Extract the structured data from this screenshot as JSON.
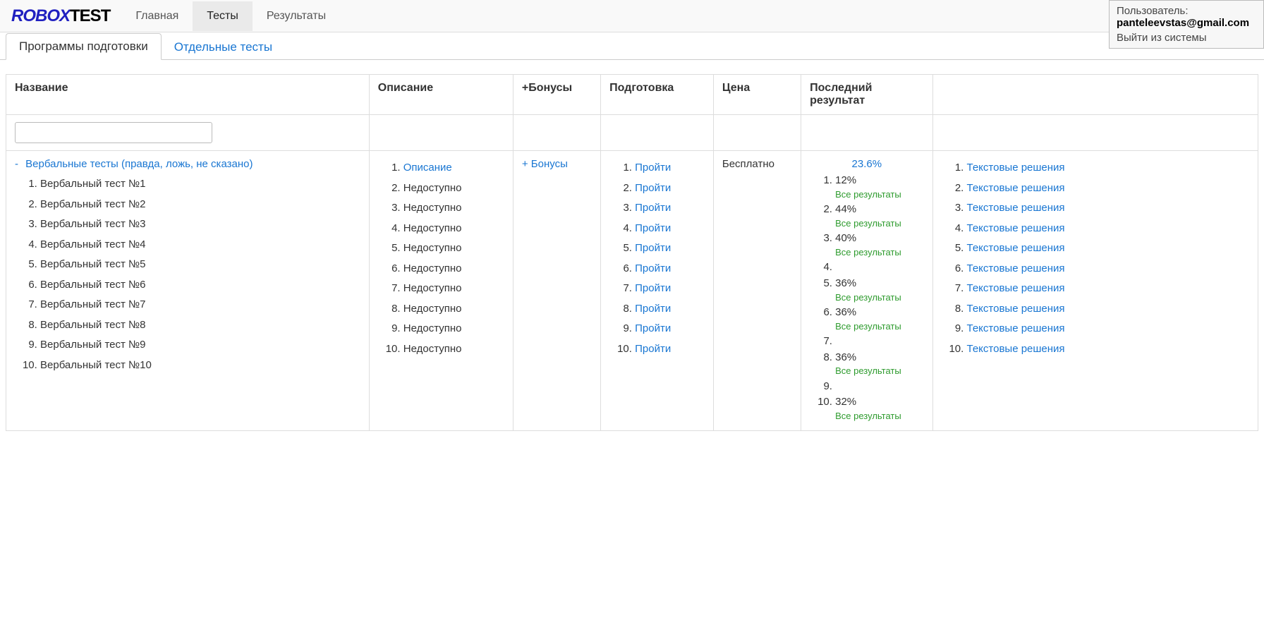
{
  "logo": {
    "part1": "ROBOX",
    "part2": "TEST"
  },
  "nav": {
    "items": [
      "Главная",
      "Тесты",
      "Результаты"
    ],
    "active": 1
  },
  "user": {
    "label": "Пользователь:",
    "email": "panteleevstas@gmail.com",
    "logout": "Выйти из системы"
  },
  "subtabs": {
    "items": [
      "Программы подготовки",
      "Отдельные тесты"
    ],
    "active": 0
  },
  "table": {
    "headers": {
      "name": "Название",
      "description": "Описание",
      "bonuses": "+Бонусы",
      "preparation": "Подготовка",
      "price": "Цена",
      "last_result": "Последний результат",
      "solutions": ""
    },
    "filter_value": "",
    "row": {
      "collapse_prefix": "-",
      "collapse_title": "Вербальные тесты (правда, ложь, не сказано)",
      "tests": [
        "Вербальный тест №1",
        "Вербальный тест №2",
        "Вербальный тест №3",
        "Вербальный тест №4",
        "Вербальный тест №5",
        "Вербальный тест №6",
        "Вербальный тест №7",
        "Вербальный тест №8",
        "Вербальный тест №9",
        "Вербальный тест №10"
      ],
      "descriptions": [
        {
          "text": "Описание",
          "link": true
        },
        {
          "text": "Недоступно",
          "link": false
        },
        {
          "text": "Недоступно",
          "link": false
        },
        {
          "text": "Недоступно",
          "link": false
        },
        {
          "text": "Недоступно",
          "link": false
        },
        {
          "text": "Недоступно",
          "link": false
        },
        {
          "text": "Недоступно",
          "link": false
        },
        {
          "text": "Недоступно",
          "link": false
        },
        {
          "text": "Недоступно",
          "link": false
        },
        {
          "text": "Недоступно",
          "link": false
        }
      ],
      "bonuses_link": "+ Бонусы",
      "preparation_label": "Пройти",
      "preparation_count": 10,
      "price": "Бесплатно",
      "result_main": "23.6%",
      "results": [
        {
          "value": "12%",
          "all": true
        },
        {
          "value": "44%",
          "all": true
        },
        {
          "value": "40%",
          "all": true
        },
        {
          "value": "",
          "all": false
        },
        {
          "value": "36%",
          "all": true
        },
        {
          "value": "36%",
          "all": true
        },
        {
          "value": "",
          "all": false
        },
        {
          "value": "36%",
          "all": true
        },
        {
          "value": "",
          "all": false
        },
        {
          "value": "32%",
          "all": true
        }
      ],
      "all_results_label": "Все результаты",
      "solution_label": "Текстовые решения",
      "solution_count": 10
    }
  }
}
